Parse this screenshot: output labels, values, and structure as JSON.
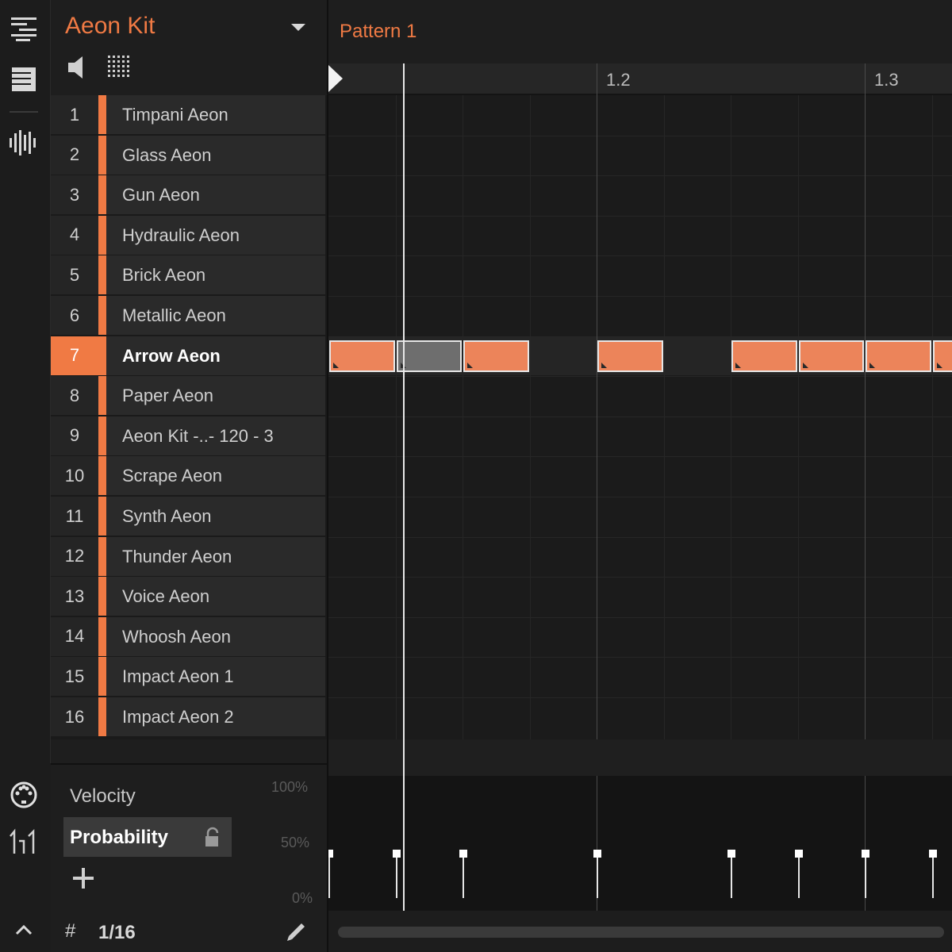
{
  "kit": {
    "title": "Aeon Kit"
  },
  "pattern": {
    "title": "Pattern 1"
  },
  "ruler": {
    "labels": [
      "1.2",
      "1.3"
    ]
  },
  "tracks": [
    {
      "num": "1",
      "name": "Timpani Aeon"
    },
    {
      "num": "2",
      "name": "Glass Aeon"
    },
    {
      "num": "3",
      "name": "Gun Aeon"
    },
    {
      "num": "4",
      "name": "Hydraulic Aeon"
    },
    {
      "num": "5",
      "name": "Brick Aeon"
    },
    {
      "num": "6",
      "name": "Metallic Aeon"
    },
    {
      "num": "7",
      "name": "Arrow Aeon",
      "selected": true
    },
    {
      "num": "8",
      "name": "Paper Aeon"
    },
    {
      "num": "9",
      "name": "Aeon Kit -..- 120 - 3"
    },
    {
      "num": "10",
      "name": "Scrape Aeon"
    },
    {
      "num": "11",
      "name": "Synth Aeon"
    },
    {
      "num": "12",
      "name": "Thunder Aeon"
    },
    {
      "num": "13",
      "name": "Voice Aeon"
    },
    {
      "num": "14",
      "name": "Whoosh Aeon"
    },
    {
      "num": "15",
      "name": "Impact Aeon 1"
    },
    {
      "num": "16",
      "name": "Impact Aeon 2"
    }
  ],
  "params": {
    "velocity_label": "Velocity",
    "probability_label": "Probability",
    "pct_100": "100%",
    "pct_50": "50%",
    "pct_0": "0%",
    "grid_resolution": "1/16",
    "grid_icon": "#"
  },
  "colors": {
    "accent": "#f07a44",
    "note": "#ec845a",
    "note_muted": "#6e6e6e"
  },
  "icons": [
    "list-view-icon",
    "pattern-list-icon",
    "waveform-icon",
    "speaker-icon",
    "grid-dots-icon",
    "dropdown-arrow-icon",
    "midi-icon",
    "velocity-icon",
    "lock-icon",
    "plus-icon",
    "grid-icon",
    "pencil-icon",
    "chevron-up-icon"
  ]
}
